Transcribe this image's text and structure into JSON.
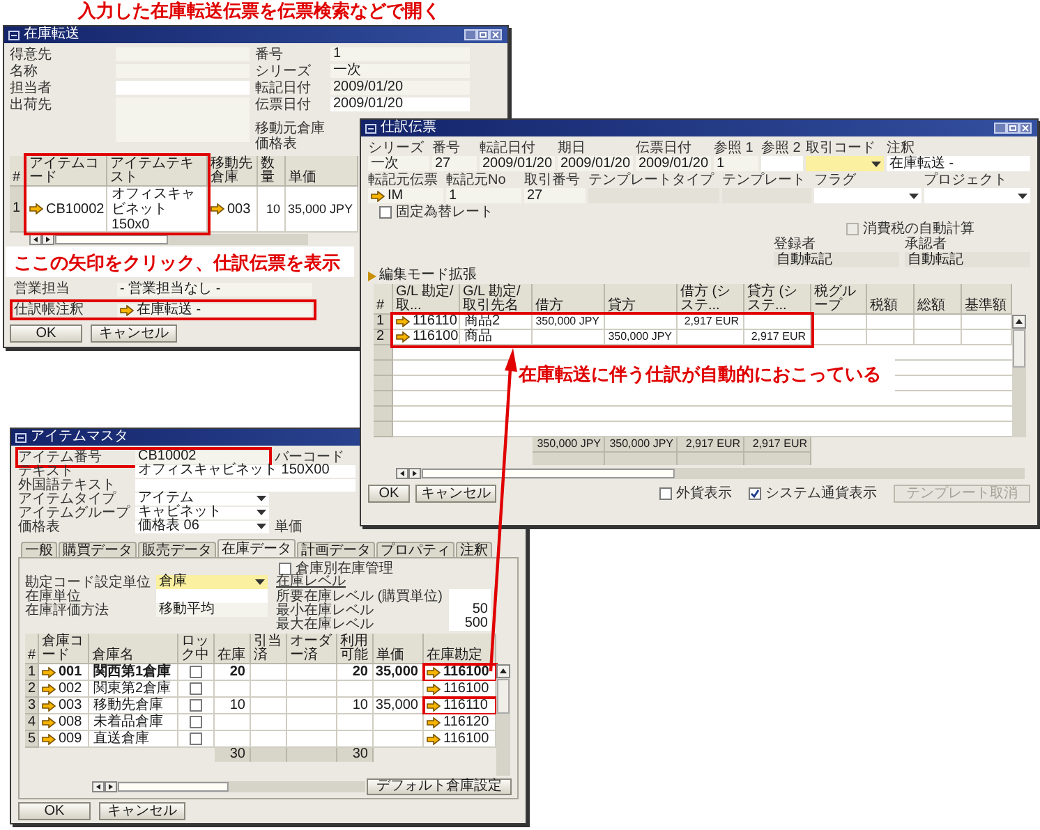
{
  "heading": "入力した在庫転送伝票を伝票検索などで開く",
  "transfer_window": {
    "title": "在庫転送",
    "left_fields": [
      {
        "label": "得意先",
        "kind": "text"
      },
      {
        "label": "名称",
        "kind": "text"
      },
      {
        "label": "担当者",
        "kind": "white"
      },
      {
        "label": "出荷先",
        "kind": "multiline"
      }
    ],
    "right_fields": [
      {
        "label": "番号",
        "value": "1",
        "kind": "text"
      },
      {
        "label": "シリーズ",
        "value": "一次",
        "kind": "text"
      },
      {
        "label": "転記日付",
        "value": "2009/01/20",
        "kind": "text"
      },
      {
        "label": "伝票日付",
        "value": "2009/01/20",
        "kind": "white"
      }
    ],
    "warehouse_labels": [
      "移動元倉庫",
      "価格表"
    ],
    "table": {
      "highlighted": true,
      "columns": [
        {
          "label": "#",
          "kind": "index"
        },
        {
          "label": "アイテムコード",
          "kind": "link"
        },
        {
          "label": "アイテムテキスト",
          "kind": "text"
        },
        {
          "label": "移動先倉庫",
          "kind": "link"
        },
        {
          "label": "数量",
          "kind": "number"
        },
        {
          "label": "単価",
          "kind": "number"
        }
      ],
      "rows": [
        {
          "number": "1",
          "item_code": "CB10002",
          "item_text": "オフィスキャビネット 150x0",
          "warehouse": "003",
          "quantity": "10",
          "price": "35,000 JPY"
        }
      ]
    },
    "bottom_fields": [
      {
        "label": "営業担当",
        "value": "- 営業担当なし -",
        "kind": "text",
        "highlighted": false
      },
      {
        "label": "仕訳帳注釈",
        "value": "在庫転送 -",
        "kind": "link",
        "highlighted": true
      }
    ],
    "buttons": [
      "OK",
      "キャンセル"
    ]
  },
  "journal_window": {
    "title": "仕訳伝票",
    "header_fields": [
      {
        "label": "シリーズ",
        "value": "一次",
        "kind": "text"
      },
      {
        "label": "番号",
        "value": "27",
        "kind": "text"
      },
      {
        "label": "転記日付",
        "value": "2009/01/20",
        "kind": "text"
      },
      {
        "label": "期日",
        "value": "2009/01/20",
        "kind": "text"
      },
      {
        "label": "伝票日付",
        "value": "2009/01/20",
        "kind": "text"
      },
      {
        "label": "参照 1",
        "value": "1",
        "kind": "text"
      },
      {
        "label": "参照 2",
        "kind": "white"
      },
      {
        "label": "取引コード",
        "kind": "active_dropdown"
      },
      {
        "label": "注釈",
        "value": "在庫転送 -",
        "kind": "white"
      }
    ],
    "source_fields": [
      {
        "label": "転記元伝票",
        "value": "IM",
        "kind": "link"
      },
      {
        "label": "転記元No",
        "value": "1",
        "kind": "text"
      },
      {
        "label": "取引番号",
        "value": "27",
        "kind": "text"
      },
      {
        "label": "テンプレートタイプ",
        "kind": "readonly"
      },
      {
        "label": "テンプレート",
        "kind": "readonly"
      },
      {
        "label": "フラグ",
        "kind": "dropdown"
      },
      {
        "label": "プロジェクト",
        "kind": "dropdown"
      }
    ],
    "checkboxes": [
      {
        "label": "固定為替レート",
        "checked": false,
        "disabled": false
      },
      {
        "label": "消費税の自動計算",
        "checked": false,
        "disabled": true
      }
    ],
    "people": [
      {
        "label": "登録者",
        "value": "自動転記"
      },
      {
        "label": "承認者",
        "value": "自動転記"
      }
    ],
    "expander": {
      "label": "編集モード拡張",
      "expanded": false
    },
    "table": {
      "columns": [
        {
          "label": "#",
          "kind": "index"
        },
        {
          "label": "G/L 勘定/取...",
          "kind": "link"
        },
        {
          "label": "G/L 勘定/取引先名",
          "kind": "text"
        },
        {
          "label": "借方",
          "kind": "number"
        },
        {
          "label": "貸方",
          "kind": "number"
        },
        {
          "label": "借方 (システ...",
          "kind": "number"
        },
        {
          "label": "貸方 (システ...",
          "kind": "number"
        },
        {
          "label": "税グループ",
          "kind": "text"
        },
        {
          "label": "税額",
          "kind": "number"
        },
        {
          "label": "総額",
          "kind": "number"
        },
        {
          "label": "基準額",
          "kind": "number"
        }
      ],
      "rows": [
        {
          "number": "1",
          "account": "116110",
          "name": "商品2",
          "debit": "350,000 JPY",
          "debit_sys": "2,917 EUR",
          "highlighted": true
        },
        {
          "number": "2",
          "account": "116100",
          "name": "商品",
          "credit": "350,000 JPY",
          "credit_sys": "2,917 EUR",
          "highlighted": true
        }
      ],
      "totals": [
        "350,000 JPY",
        "350,000 JPY",
        "2,917 EUR",
        "2,917 EUR"
      ]
    },
    "options": [
      {
        "label": "外貨表示",
        "checked": false
      },
      {
        "label": "システム通貨表示",
        "checked": true
      }
    ],
    "template_button": {
      "label": "テンプレート取消",
      "disabled": true
    },
    "buttons": [
      "OK",
      "キャンセル"
    ]
  },
  "item_window": {
    "title": "アイテムマスタ",
    "fields": [
      {
        "label": "アイテム番号",
        "value": "CB10002",
        "kind": "text",
        "highlighted": true,
        "side_label": "バーコード"
      },
      {
        "label": "テキスト",
        "value": "オフィスキャビネット 150X00",
        "kind": "white",
        "highlighted": false
      },
      {
        "label": "外国語テキスト",
        "kind": "white",
        "highlighted": false
      },
      {
        "label": "アイテムタイプ",
        "value": "アイテム",
        "kind": "dropdown",
        "highlighted": false
      },
      {
        "label": "アイテムグループ",
        "value": "キャビネット",
        "kind": "dropdown",
        "highlighted": false
      },
      {
        "label": "価格表",
        "value": "価格表 06",
        "kind": "dropdown",
        "highlighted": false,
        "side_label": "単価"
      }
    ],
    "tabs": [
      {
        "label": "一般",
        "selected": false
      },
      {
        "label": "購買データ",
        "selected": false
      },
      {
        "label": "販売データ",
        "selected": false
      },
      {
        "label": "在庫データ",
        "selected": true
      },
      {
        "label": "計画データ",
        "selected": false
      },
      {
        "label": "プロパティ",
        "selected": false
      },
      {
        "label": "注釈",
        "selected": false
      }
    ],
    "stock_panel": {
      "checkbox": {
        "label": "倉庫別在庫管理",
        "checked": false
      },
      "fields": [
        {
          "label": "勘定コード設定単位",
          "value": "倉庫",
          "kind": "active_dropdown"
        },
        {
          "label": "在庫単位",
          "kind": "white"
        },
        {
          "label": "在庫評価方法",
          "value": "移動平均",
          "kind": "text"
        }
      ],
      "level_heading": "在庫レベル",
      "level_fields": [
        {
          "label": "所要在庫レベル (購買単位)"
        },
        {
          "label": "最小在庫レベル",
          "value": "50"
        },
        {
          "label": "最大在庫レベル",
          "value": "500"
        }
      ]
    },
    "warehouses": {
      "columns": [
        {
          "label": "#",
          "kind": "index"
        },
        {
          "label": "倉庫コード",
          "kind": "link"
        },
        {
          "label": "倉庫名",
          "kind": "text"
        },
        {
          "label": "ロック中",
          "kind": "checkbox"
        },
        {
          "label": "在庫",
          "kind": "number"
        },
        {
          "label": "引当済",
          "kind": "number"
        },
        {
          "label": "オーダー済",
          "kind": "number"
        },
        {
          "label": "利用可能",
          "kind": "number"
        },
        {
          "label": "単価",
          "kind": "number"
        },
        {
          "label": "在庫勘定",
          "kind": "link"
        }
      ],
      "rows": [
        {
          "number": "1",
          "code": "001",
          "name": "関西第1倉庫",
          "locked": false,
          "in_stock": "20",
          "available": "20",
          "price": "35,000",
          "account": "116100",
          "default": true,
          "highlighted": true
        },
        {
          "number": "2",
          "code": "002",
          "name": "関東第2倉庫",
          "locked": false,
          "account": "116100",
          "default": false,
          "highlighted": false
        },
        {
          "number": "3",
          "code": "003",
          "name": "移動先倉庫",
          "locked": false,
          "in_stock": "10",
          "available": "10",
          "price": "35,000",
          "account": "116110",
          "default": false,
          "highlighted": true
        },
        {
          "number": "4",
          "code": "008",
          "name": "未着品倉庫",
          "locked": false,
          "account": "116120",
          "default": false,
          "highlighted": false
        },
        {
          "number": "5",
          "code": "009",
          "name": "直送倉庫",
          "locked": false,
          "account": "116100",
          "default": false,
          "highlighted": false
        }
      ],
      "totals": {
        "in_stock": "30",
        "available": "30"
      }
    },
    "default_button": "デフォルト倉庫設定",
    "buttons": [
      "OK",
      "キャンセル"
    ]
  },
  "callouts": [
    "ここの矢印をクリック、仕訳伝票を表示",
    "在庫転送に伴う仕訳が自動的におこっている"
  ]
}
